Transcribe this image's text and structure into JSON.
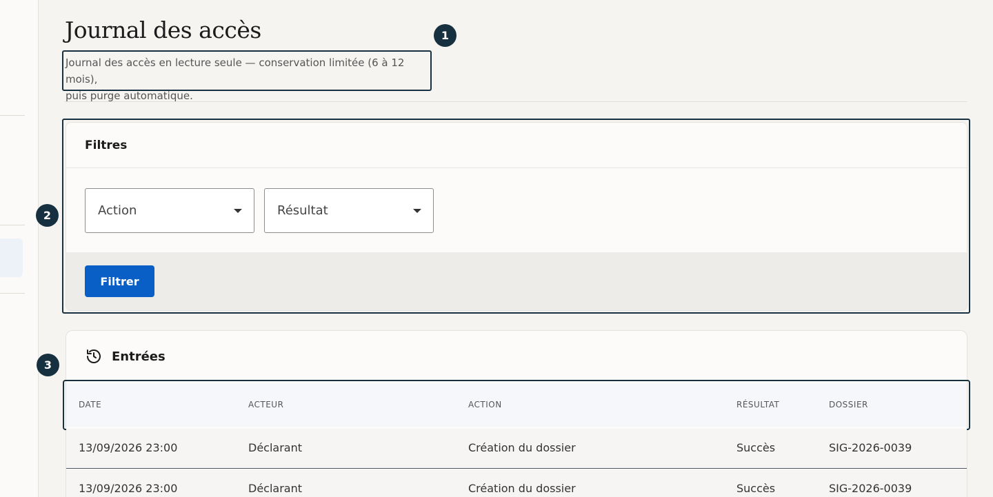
{
  "header": {
    "title": "Journal des accès",
    "subtitle_line1": "Journal des accès en lecture seule — conservation limitée (6 à 12 mois),",
    "subtitle_line2": "puis purge automatique."
  },
  "markers": [
    "1",
    "2",
    "3"
  ],
  "filters": {
    "title": "Filtres",
    "action_select": "Action",
    "result_select": "Résultat",
    "submit_label": "Filtrer"
  },
  "entries": {
    "title": "Entrées",
    "icon": "history-icon",
    "columns": [
      "DATE",
      "ACTEUR",
      "ACTION",
      "RÉSULTAT",
      "DOSSIER"
    ],
    "rows": [
      {
        "date": "13/09/2026 23:00",
        "actor": "Déclarant",
        "action": "Création du dossier",
        "result": "Succès",
        "dossier": "SIG-2026-0039"
      },
      {
        "date": "13/09/2026 23:00",
        "actor": "Déclarant",
        "action": "Création du dossier",
        "result": "Succès",
        "dossier": "SIG-2026-0039"
      }
    ]
  },
  "colors": {
    "accent": "#0a5fc6",
    "marker": "#16303f",
    "background": "#f5f4f1"
  }
}
